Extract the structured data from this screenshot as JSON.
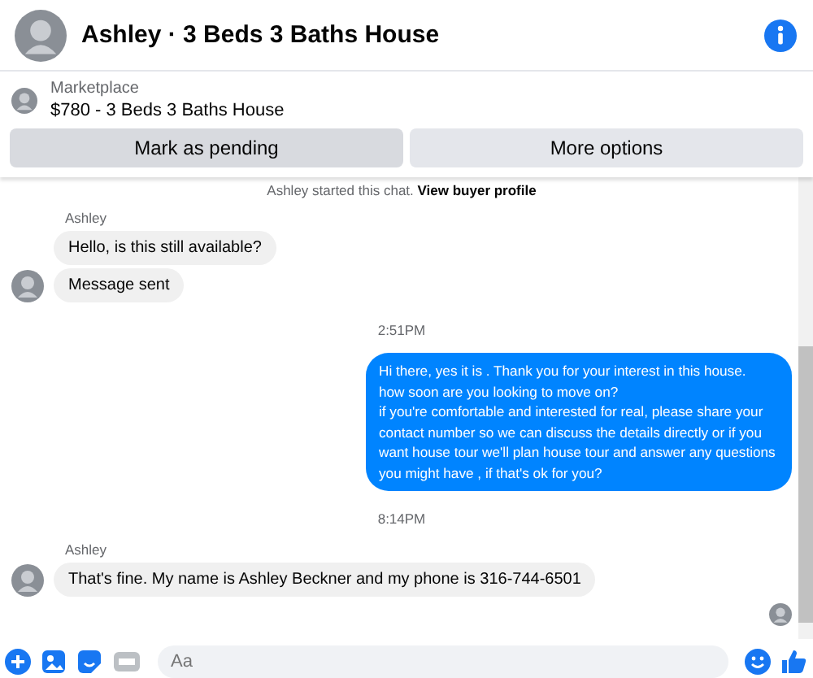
{
  "header": {
    "title": "Ashley · 3 Beds 3 Baths House"
  },
  "listing": {
    "label": "Marketplace",
    "title": "$780 - 3 Beds 3 Baths House"
  },
  "actions": [
    {
      "label": "Mark as pending",
      "kind": "primary"
    },
    {
      "label": "More options",
      "kind": "secondary"
    }
  ],
  "notice": {
    "text": "Ashley started this chat.",
    "link": "View buyer profile"
  },
  "messages": [
    {
      "kind": "sender",
      "text": "Ashley"
    },
    {
      "kind": "incoming",
      "text": "Hello, is this still available?",
      "avatar": false
    },
    {
      "kind": "incoming",
      "text": "Message sent",
      "avatar": true
    },
    {
      "kind": "time",
      "text": "2:51PM"
    },
    {
      "kind": "outgoing",
      "text": "Hi there, yes it is . Thank you for your interest in this house.\nhow soon are you looking to move on?\nif you're comfortable and interested for real, please share your contact number so we can discuss the details directly or if you  want house tour we'll plan house tour and answer any questions you might have , if that's ok for you?"
    },
    {
      "kind": "time",
      "text": "8:14PM"
    },
    {
      "kind": "sender",
      "text": "Ashley"
    },
    {
      "kind": "incoming",
      "text": "That's fine.  My name is Ashley Beckner and my phone is 316-744-6501",
      "avatar": true
    },
    {
      "kind": "seen"
    }
  ],
  "composer": {
    "placeholder": "Aa"
  }
}
